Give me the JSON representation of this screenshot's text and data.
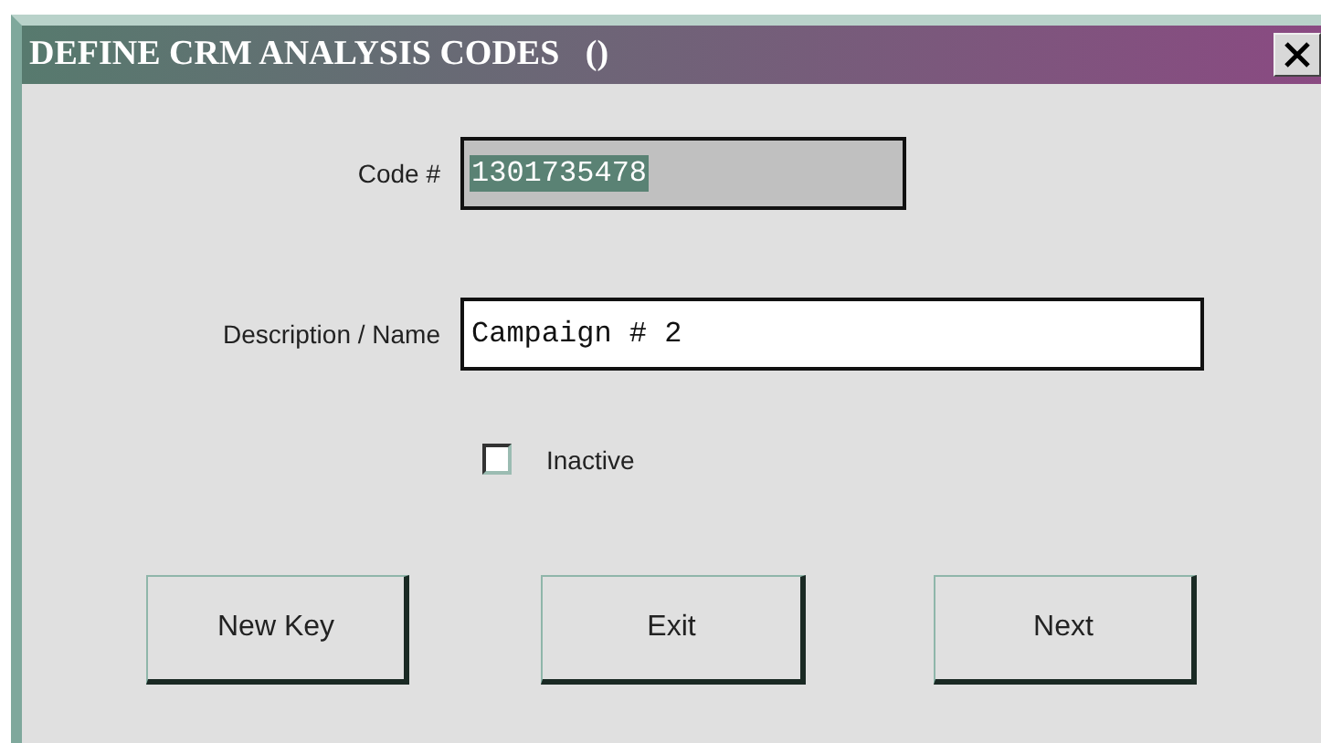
{
  "window": {
    "title": "DEFINE CRM ANALYSIS CODES   ()"
  },
  "code_field": {
    "label": "Code #",
    "value": "1301735478",
    "value_selected": true,
    "disabled": true
  },
  "description_field": {
    "label": "Description / Name",
    "value": "Campaign # 2"
  },
  "inactive_checkbox": {
    "label": "Inactive",
    "checked": false
  },
  "buttons": [
    {
      "label": "New Key"
    },
    {
      "label": "Exit"
    },
    {
      "label": "Next"
    }
  ]
}
